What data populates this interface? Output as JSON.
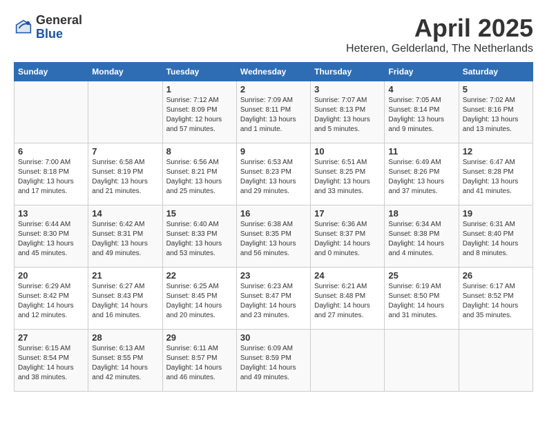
{
  "header": {
    "logo": {
      "general": "General",
      "blue": "Blue"
    },
    "title": "April 2025",
    "subtitle": "Heteren, Gelderland, The Netherlands"
  },
  "days_of_week": [
    "Sunday",
    "Monday",
    "Tuesday",
    "Wednesday",
    "Thursday",
    "Friday",
    "Saturday"
  ],
  "weeks": [
    [
      {
        "day": "",
        "info": ""
      },
      {
        "day": "",
        "info": ""
      },
      {
        "day": "1",
        "info": "Sunrise: 7:12 AM\nSunset: 8:09 PM\nDaylight: 12 hours and 57 minutes."
      },
      {
        "day": "2",
        "info": "Sunrise: 7:09 AM\nSunset: 8:11 PM\nDaylight: 13 hours and 1 minute."
      },
      {
        "day": "3",
        "info": "Sunrise: 7:07 AM\nSunset: 8:13 PM\nDaylight: 13 hours and 5 minutes."
      },
      {
        "day": "4",
        "info": "Sunrise: 7:05 AM\nSunset: 8:14 PM\nDaylight: 13 hours and 9 minutes."
      },
      {
        "day": "5",
        "info": "Sunrise: 7:02 AM\nSunset: 8:16 PM\nDaylight: 13 hours and 13 minutes."
      }
    ],
    [
      {
        "day": "6",
        "info": "Sunrise: 7:00 AM\nSunset: 8:18 PM\nDaylight: 13 hours and 17 minutes."
      },
      {
        "day": "7",
        "info": "Sunrise: 6:58 AM\nSunset: 8:19 PM\nDaylight: 13 hours and 21 minutes."
      },
      {
        "day": "8",
        "info": "Sunrise: 6:56 AM\nSunset: 8:21 PM\nDaylight: 13 hours and 25 minutes."
      },
      {
        "day": "9",
        "info": "Sunrise: 6:53 AM\nSunset: 8:23 PM\nDaylight: 13 hours and 29 minutes."
      },
      {
        "day": "10",
        "info": "Sunrise: 6:51 AM\nSunset: 8:25 PM\nDaylight: 13 hours and 33 minutes."
      },
      {
        "day": "11",
        "info": "Sunrise: 6:49 AM\nSunset: 8:26 PM\nDaylight: 13 hours and 37 minutes."
      },
      {
        "day": "12",
        "info": "Sunrise: 6:47 AM\nSunset: 8:28 PM\nDaylight: 13 hours and 41 minutes."
      }
    ],
    [
      {
        "day": "13",
        "info": "Sunrise: 6:44 AM\nSunset: 8:30 PM\nDaylight: 13 hours and 45 minutes."
      },
      {
        "day": "14",
        "info": "Sunrise: 6:42 AM\nSunset: 8:31 PM\nDaylight: 13 hours and 49 minutes."
      },
      {
        "day": "15",
        "info": "Sunrise: 6:40 AM\nSunset: 8:33 PM\nDaylight: 13 hours and 53 minutes."
      },
      {
        "day": "16",
        "info": "Sunrise: 6:38 AM\nSunset: 8:35 PM\nDaylight: 13 hours and 56 minutes."
      },
      {
        "day": "17",
        "info": "Sunrise: 6:36 AM\nSunset: 8:37 PM\nDaylight: 14 hours and 0 minutes."
      },
      {
        "day": "18",
        "info": "Sunrise: 6:34 AM\nSunset: 8:38 PM\nDaylight: 14 hours and 4 minutes."
      },
      {
        "day": "19",
        "info": "Sunrise: 6:31 AM\nSunset: 8:40 PM\nDaylight: 14 hours and 8 minutes."
      }
    ],
    [
      {
        "day": "20",
        "info": "Sunrise: 6:29 AM\nSunset: 8:42 PM\nDaylight: 14 hours and 12 minutes."
      },
      {
        "day": "21",
        "info": "Sunrise: 6:27 AM\nSunset: 8:43 PM\nDaylight: 14 hours and 16 minutes."
      },
      {
        "day": "22",
        "info": "Sunrise: 6:25 AM\nSunset: 8:45 PM\nDaylight: 14 hours and 20 minutes."
      },
      {
        "day": "23",
        "info": "Sunrise: 6:23 AM\nSunset: 8:47 PM\nDaylight: 14 hours and 23 minutes."
      },
      {
        "day": "24",
        "info": "Sunrise: 6:21 AM\nSunset: 8:48 PM\nDaylight: 14 hours and 27 minutes."
      },
      {
        "day": "25",
        "info": "Sunrise: 6:19 AM\nSunset: 8:50 PM\nDaylight: 14 hours and 31 minutes."
      },
      {
        "day": "26",
        "info": "Sunrise: 6:17 AM\nSunset: 8:52 PM\nDaylight: 14 hours and 35 minutes."
      }
    ],
    [
      {
        "day": "27",
        "info": "Sunrise: 6:15 AM\nSunset: 8:54 PM\nDaylight: 14 hours and 38 minutes."
      },
      {
        "day": "28",
        "info": "Sunrise: 6:13 AM\nSunset: 8:55 PM\nDaylight: 14 hours and 42 minutes."
      },
      {
        "day": "29",
        "info": "Sunrise: 6:11 AM\nSunset: 8:57 PM\nDaylight: 14 hours and 46 minutes."
      },
      {
        "day": "30",
        "info": "Sunrise: 6:09 AM\nSunset: 8:59 PM\nDaylight: 14 hours and 49 minutes."
      },
      {
        "day": "",
        "info": ""
      },
      {
        "day": "",
        "info": ""
      },
      {
        "day": "",
        "info": ""
      }
    ]
  ]
}
